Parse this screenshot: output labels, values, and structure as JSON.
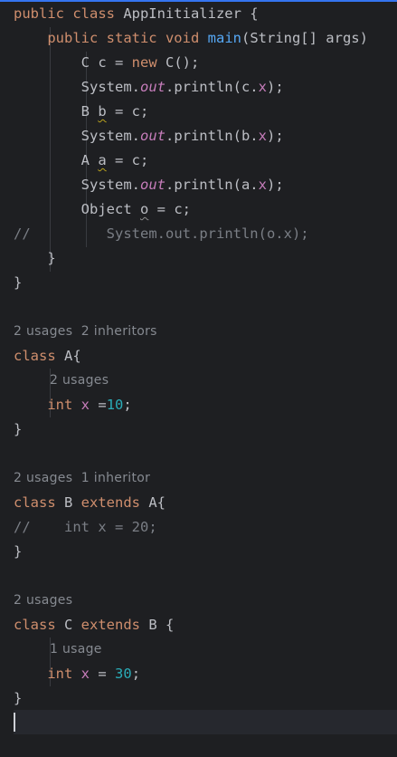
{
  "code": {
    "l1": {
      "kw": "public class",
      "name": " AppInitializer {"
    },
    "l2": {
      "kw": "public static void",
      "fn": "main",
      "rest": "(String[] args)"
    },
    "l3": {
      "a": "C c = ",
      "kw": "new",
      "b": " C();"
    },
    "l4": {
      "a": "System.",
      "out": "out",
      "b": ".println(c.",
      "field": "x",
      "c": ");"
    },
    "l5": {
      "a": "B ",
      "var": "b",
      "b": " = c;"
    },
    "l6": {
      "a": "System.",
      "out": "out",
      "b": ".println(b.",
      "field": "x",
      "c": ");"
    },
    "l7": {
      "a": "A ",
      "var": "a",
      "b": " = c;"
    },
    "l8": {
      "a": "System.",
      "out": "out",
      "b": ".println(a.",
      "field": "x",
      "c": ");"
    },
    "l9": {
      "a": "Object ",
      "var": "o",
      "b": " = c;"
    },
    "l10": {
      "slash": "//",
      "text": "System.out.println(o.x);"
    },
    "l11": "}",
    "l12": "}",
    "hintA": "2 usages  2 inheritors",
    "classA": {
      "kw": "class",
      "rest": " A{"
    },
    "hintAx": "2 usages",
    "fieldA": {
      "kw": "int",
      "field": "x",
      "eq": " =",
      "num": "10",
      "end": ";"
    },
    "closeA": "}",
    "hintB": "2 usages  1 inheritor",
    "classB": {
      "kw": "class",
      "b": " B ",
      "kw2": "extends",
      "c": " A{"
    },
    "commentB": {
      "slash": "//",
      "text": "int x = 20;"
    },
    "closeB": "}",
    "hintC": "2 usages",
    "classC": {
      "kw": "class",
      "b": " C ",
      "kw2": "extends",
      "c": " B {"
    },
    "hintCx": "1 usage",
    "fieldC": {
      "kw": "int",
      "field": "x",
      "eq": " = ",
      "num": "30",
      "end": ";"
    },
    "closeC": "}"
  },
  "colors": {
    "background": "#1e1f22",
    "keyword": "#cf8e6d",
    "method": "#56a8f5",
    "field": "#c77dbb",
    "number": "#2aacb8",
    "comment": "#7a7e85",
    "text": "#bcbec4"
  }
}
